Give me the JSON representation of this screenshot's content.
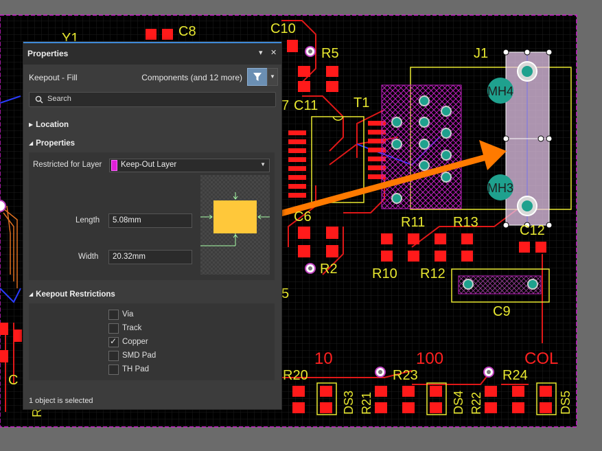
{
  "board": {
    "labels": {
      "y1": "Y1",
      "c8": "C8",
      "c10": "C10",
      "r5": "R5",
      "j1": "J1",
      "seven": "7",
      "c11": "C11",
      "t1": "T1",
      "mh4": "MH4",
      "mh3": "MH3",
      "c6": "C6",
      "r11": "R11",
      "r13": "R13",
      "c12": "C12",
      "r2": "R2",
      "r10": "R10",
      "r12": "R12",
      "five": "5",
      "c9": "C9",
      "ten": "10",
      "hundred": "100",
      "col": "COL",
      "r20": "R20",
      "r23": "R23",
      "r24": "R24",
      "r21": "R21",
      "r22": "R22",
      "ds3": "DS3",
      "ds4": "DS4",
      "ds5": "DS5",
      "c_left": "C",
      "r_left": "R"
    },
    "colors": {
      "background": "#000000",
      "grid": "#1c1c1c",
      "copper": "#ff1a1a",
      "silk": "#ffff33",
      "keepout": "#cc44cc",
      "pad_ring": "#c9c9c9",
      "hole_teal": "#1fa18e",
      "arrow": "#ff7a00"
    }
  },
  "panel": {
    "title": "Properties",
    "pin_icon": "▾",
    "close_icon": "✕",
    "object_type": "Keepout - Fill",
    "filter_label": "Components (and 12 more)",
    "search_placeholder": "Search",
    "sections": {
      "location": "Location",
      "properties": "Properties",
      "keepout_restrictions": "Keepout Restrictions"
    },
    "restricted_for_layer_label": "Restricted for Layer",
    "restricted_for_layer_value": "Keep-Out Layer",
    "length_label": "Length",
    "length_value": "5.08mm",
    "width_label": "Width",
    "width_value": "20.32mm",
    "restrictions": [
      {
        "label": "Via",
        "checked": false
      },
      {
        "label": "Track",
        "checked": false
      },
      {
        "label": "Copper",
        "checked": true
      },
      {
        "label": "SMD Pad",
        "checked": false
      },
      {
        "label": "TH Pad",
        "checked": false
      }
    ],
    "status": "1 object is selected"
  }
}
